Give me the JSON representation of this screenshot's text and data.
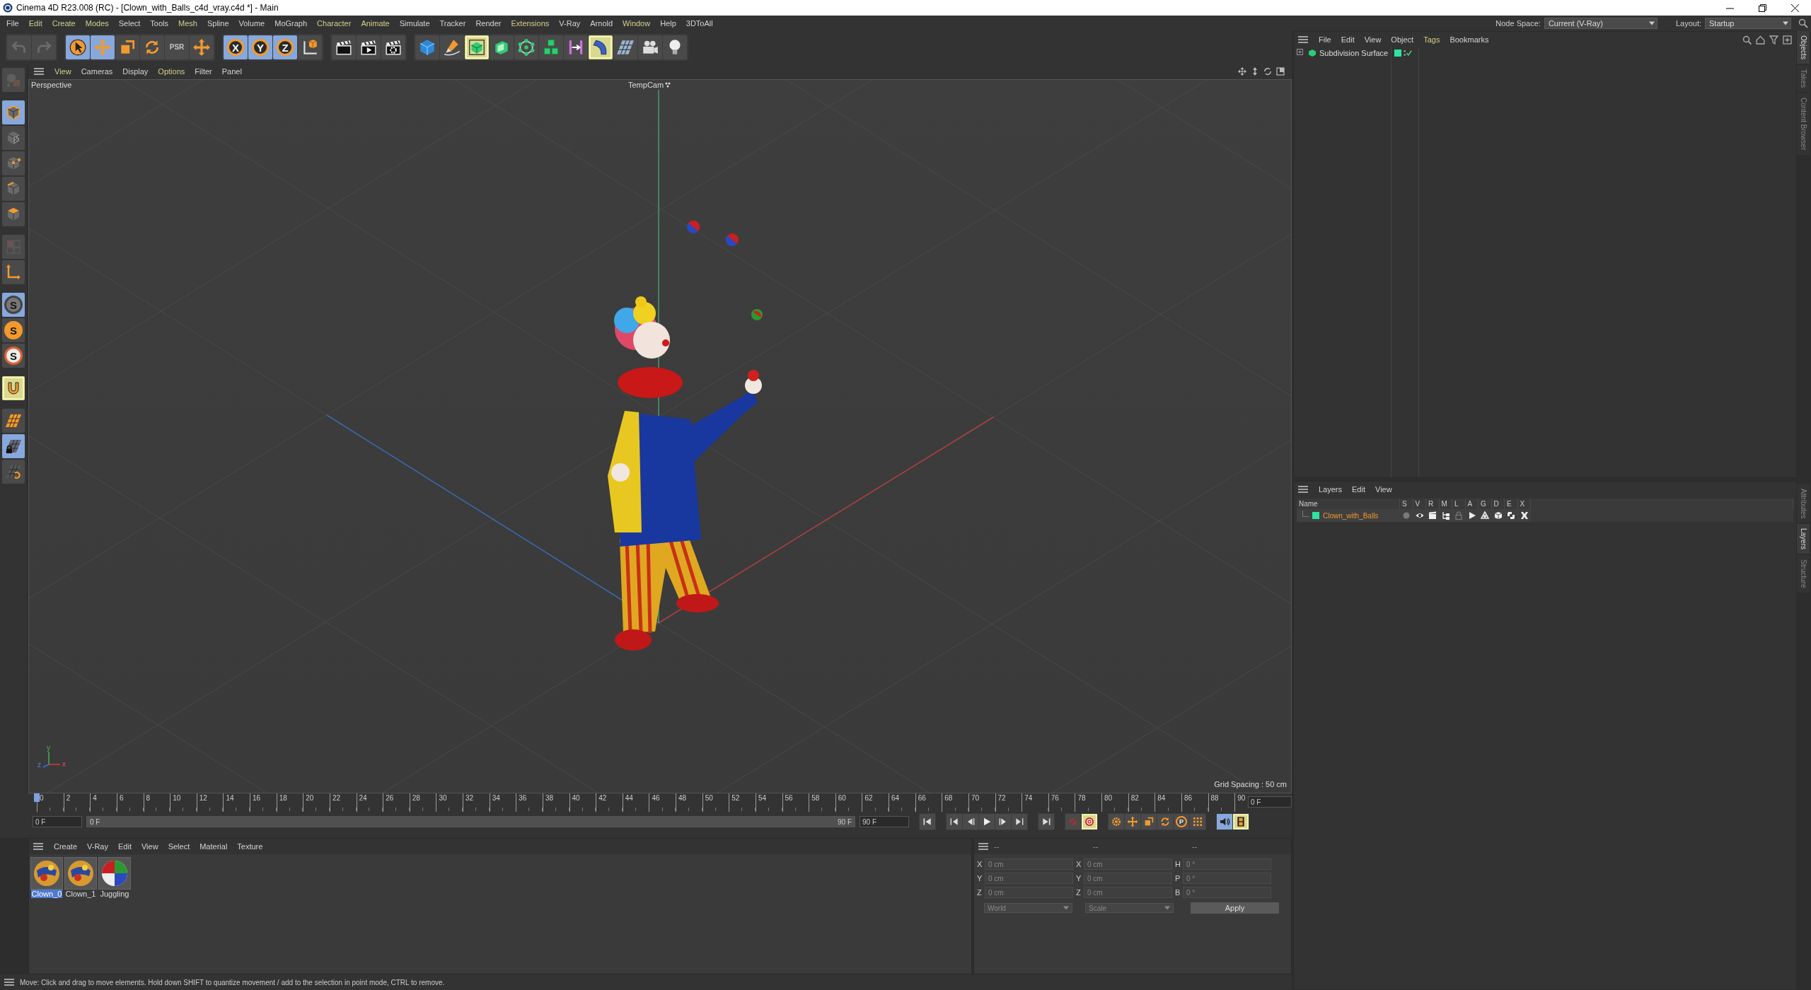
{
  "window": {
    "title": "Cinema 4D R23.008 (RC) - [Clown_with_Balls_c4d_vray.c4d *] - Main"
  },
  "menu_bar": {
    "items": [
      {
        "label": "File",
        "highlighted": false
      },
      {
        "label": "Edit",
        "highlighted": true
      },
      {
        "label": "Create",
        "highlighted": true
      },
      {
        "label": "Modes",
        "highlighted": true
      },
      {
        "label": "Select",
        "highlighted": false
      },
      {
        "label": "Tools",
        "highlighted": false
      },
      {
        "label": "Mesh",
        "highlighted": true
      },
      {
        "label": "Spline",
        "highlighted": false
      },
      {
        "label": "Volume",
        "highlighted": false
      },
      {
        "label": "MoGraph",
        "highlighted": false
      },
      {
        "label": "Character",
        "highlighted": true
      },
      {
        "label": "Animate",
        "highlighted": true
      },
      {
        "label": "Simulate",
        "highlighted": false
      },
      {
        "label": "Tracker",
        "highlighted": false
      },
      {
        "label": "Render",
        "highlighted": false
      },
      {
        "label": "Extensions",
        "highlighted": true
      },
      {
        "label": "V-Ray",
        "highlighted": false
      },
      {
        "label": "Arnold",
        "highlighted": false
      },
      {
        "label": "Window",
        "highlighted": true
      },
      {
        "label": "Help",
        "highlighted": false
      },
      {
        "label": "3DToAll",
        "highlighted": false
      }
    ],
    "node_space": {
      "label": "Node Space:",
      "value": "Current (V-Ray)"
    },
    "layout": {
      "label": "Layout:",
      "value": "Startup"
    }
  },
  "toolbar": [
    {
      "kind": "undo",
      "selected": false,
      "active": false,
      "disabled": true
    },
    {
      "kind": "redo",
      "selected": false,
      "active": false,
      "disabled": true
    },
    {
      "kind": "select",
      "selected": true,
      "active": false,
      "disabled": false
    },
    {
      "kind": "move",
      "selected": true,
      "active": false,
      "disabled": false
    },
    {
      "kind": "scale",
      "selected": false,
      "active": false,
      "disabled": false
    },
    {
      "kind": "rotate",
      "selected": false,
      "active": false,
      "disabled": false
    },
    {
      "kind": "psr",
      "label": "PSR",
      "selected": false,
      "active": false,
      "disabled": true
    },
    {
      "kind": "cross",
      "selected": false,
      "active": false,
      "disabled": false
    },
    {
      "kind": "axis",
      "label": "X",
      "selected": true,
      "active": false,
      "disabled": false
    },
    {
      "kind": "axis",
      "label": "Y",
      "selected": true,
      "active": false,
      "disabled": false
    },
    {
      "kind": "axis",
      "label": "Z",
      "selected": true,
      "active": false,
      "disabled": false
    },
    {
      "kind": "coords",
      "selected": false,
      "active": false,
      "disabled": false
    },
    {
      "kind": "clapper",
      "selected": false,
      "active": false,
      "disabled": false
    },
    {
      "kind": "render",
      "selected": false,
      "active": false,
      "disabled": false
    },
    {
      "kind": "render_settings",
      "selected": false,
      "active": false,
      "disabled": false
    },
    {
      "kind": "cube",
      "selected": false,
      "active": false,
      "disabled": false
    },
    {
      "kind": "pen",
      "selected": false,
      "active": false,
      "disabled": false
    },
    {
      "kind": "subdiv",
      "selected": false,
      "active": true,
      "disabled": false
    },
    {
      "kind": "extrude",
      "selected": false,
      "active": false,
      "disabled": false
    },
    {
      "kind": "cloner",
      "selected": false,
      "active": false,
      "disabled": false
    },
    {
      "kind": "cubes",
      "selected": false,
      "active": false,
      "disabled": false
    },
    {
      "kind": "bend",
      "selected": false,
      "active": false,
      "disabled": false
    },
    {
      "kind": "field",
      "selected": false,
      "active": true,
      "disabled": false
    },
    {
      "kind": "floor",
      "selected": false,
      "active": false,
      "disabled": false
    },
    {
      "kind": "camera",
      "selected": false,
      "active": false,
      "disabled": false
    },
    {
      "kind": "light",
      "selected": false,
      "active": false,
      "disabled": false
    }
  ],
  "left_toolbar": [
    {
      "kind": "editable",
      "selected": false,
      "active": false,
      "disabled": true
    },
    {
      "kind": "model",
      "selected": true,
      "active": false,
      "disabled": false
    },
    {
      "kind": "texture",
      "selected": false,
      "active": false,
      "disabled": false
    },
    {
      "kind": "points",
      "selected": false,
      "active": false,
      "disabled": false
    },
    {
      "kind": "edges",
      "selected": false,
      "active": false,
      "disabled": false
    },
    {
      "kind": "polys",
      "selected": false,
      "active": false,
      "disabled": false
    },
    {
      "kind": "uv",
      "selected": false,
      "active": false,
      "disabled": true
    },
    {
      "kind": "axis_mode",
      "selected": false,
      "active": false,
      "disabled": false
    },
    {
      "kind": "snap",
      "label": "S",
      "selected": true,
      "active": false,
      "disabled": false
    },
    {
      "kind": "snap_orange",
      "label": "S",
      "selected": false,
      "active": false,
      "disabled": false
    },
    {
      "kind": "snap_white",
      "label": "S",
      "selected": false,
      "active": false,
      "disabled": false
    },
    {
      "kind": "magnet",
      "selected": false,
      "active": true,
      "disabled": false
    },
    {
      "kind": "gridplane",
      "selected": false,
      "active": false,
      "disabled": false
    },
    {
      "kind": "gridlock",
      "selected": true,
      "active": false,
      "disabled": false
    },
    {
      "kind": "gridrot",
      "selected": false,
      "active": false,
      "disabled": false
    }
  ],
  "viewport": {
    "menu": [
      {
        "label": "View",
        "highlighted": true
      },
      {
        "label": "Cameras",
        "highlighted": false
      },
      {
        "label": "Display",
        "highlighted": false
      },
      {
        "label": "Options",
        "highlighted": true
      },
      {
        "label": "Filter",
        "highlighted": false
      },
      {
        "label": "Panel",
        "highlighted": false
      }
    ],
    "camera": "Perspective",
    "active_camera": "TempCam",
    "grid_spacing": "Grid Spacing : 50 cm",
    "gizmo_labels": [
      "z",
      "y",
      "x"
    ]
  },
  "objects_panel": {
    "menu": [
      {
        "label": "File",
        "highlighted": false
      },
      {
        "label": "Edit",
        "highlighted": false
      },
      {
        "label": "View",
        "highlighted": false
      },
      {
        "label": "Object",
        "highlighted": false
      },
      {
        "label": "Tags",
        "highlighted": true
      },
      {
        "label": "Bookmarks",
        "highlighted": false
      }
    ],
    "objects": [
      {
        "name": "Subdivision Surface",
        "color": "#2ee59d",
        "enabled": true
      }
    ]
  },
  "side_tabs": [
    {
      "label": "Objects",
      "selected": true
    },
    {
      "label": "Takes",
      "selected": false
    },
    {
      "label": "Content Browser",
      "selected": false
    }
  ],
  "layers_panel": {
    "menu": [
      {
        "label": "Layers",
        "highlighted": false
      },
      {
        "label": "Edit",
        "highlighted": false
      },
      {
        "label": "View",
        "highlighted": false
      }
    ],
    "columns": [
      "Name",
      "S",
      "V",
      "R",
      "M",
      "L",
      "A",
      "G",
      "D",
      "E",
      "X"
    ],
    "layers": [
      {
        "name": "Clown_with_Balls",
        "color": "#2ee5a0",
        "flags": [
          {
            "kind": "solo",
            "on": false
          },
          {
            "kind": "view",
            "on": true
          },
          {
            "kind": "render",
            "on": true
          },
          {
            "kind": "manager",
            "on": true
          },
          {
            "kind": "lock",
            "on": false
          },
          {
            "kind": "animation",
            "on": true
          },
          {
            "kind": "generators",
            "on": true
          },
          {
            "kind": "deformers",
            "on": true
          },
          {
            "kind": "expressions",
            "on": true
          },
          {
            "kind": "xrefs",
            "on": true
          }
        ]
      }
    ]
  },
  "side_tabs_lower": [
    {
      "label": "Attributes",
      "selected": false
    },
    {
      "label": "Layers",
      "selected": true
    },
    {
      "label": "Structure",
      "selected": false
    }
  ],
  "timeline": {
    "ticks": [
      "0",
      "2",
      "4",
      "6",
      "8",
      "10",
      "12",
      "14",
      "16",
      "18",
      "20",
      "22",
      "24",
      "26",
      "28",
      "30",
      "32",
      "34",
      "36",
      "38",
      "40",
      "42",
      "44",
      "46",
      "48",
      "50",
      "52",
      "54",
      "56",
      "58",
      "60",
      "62",
      "64",
      "66",
      "68",
      "70",
      "72",
      "74",
      "76",
      "78",
      "80",
      "82",
      "84",
      "86",
      "88",
      "90"
    ],
    "current_frame": "0 F",
    "start_field": "0 F",
    "range": {
      "start": "0 F",
      "end": "90 F",
      "level": 1
    },
    "end_field": "90 F",
    "controls": [
      {
        "kind": "first",
        "selected": false,
        "active": false
      },
      {
        "kind": "prev_key",
        "selected": false,
        "active": false
      },
      {
        "kind": "prev_frame",
        "selected": false,
        "active": false
      },
      {
        "kind": "play",
        "selected": false,
        "active": false
      },
      {
        "kind": "next_frame",
        "selected": false,
        "active": false
      },
      {
        "kind": "next_key",
        "selected": false,
        "active": false
      },
      {
        "kind": "last",
        "selected": false,
        "active": false
      },
      {
        "kind": "autokey",
        "selected": false,
        "active": false
      },
      {
        "kind": "record",
        "selected": false,
        "active": true
      },
      {
        "kind": "key_gear",
        "selected": false,
        "active": false
      },
      {
        "kind": "key_move",
        "selected": false,
        "active": false
      },
      {
        "kind": "key_scale",
        "selected": false,
        "active": false
      },
      {
        "kind": "key_rotate",
        "selected": false,
        "active": false
      },
      {
        "kind": "key_param",
        "label": "P",
        "selected": false,
        "active": false
      },
      {
        "kind": "key_grid",
        "selected": false,
        "active": false
      },
      {
        "kind": "sound",
        "selected": true,
        "active": false
      },
      {
        "kind": "film",
        "selected": false,
        "active": true
      }
    ]
  },
  "materials_panel": {
    "menu": [
      {
        "label": "Create",
        "highlighted": false
      },
      {
        "label": "V-Ray",
        "highlighted": false
      },
      {
        "label": "Edit",
        "highlighted": false
      },
      {
        "label": "View",
        "highlighted": false
      },
      {
        "label": "Select",
        "highlighted": false
      },
      {
        "label": "Material",
        "highlighted": false
      },
      {
        "label": "Texture",
        "highlighted": false
      }
    ],
    "materials": [
      {
        "label": "Clown_0",
        "kind": "clown",
        "selected": true
      },
      {
        "label": "Clown_1",
        "kind": "clown",
        "selected": false
      },
      {
        "label": "Juggling",
        "kind": "ball",
        "selected": false
      }
    ]
  },
  "coordinates_panel": {
    "headers": [
      "--",
      "--",
      "--"
    ],
    "rows": [
      [
        {
          "axis": "X",
          "placeholder": "0 cm"
        },
        {
          "axis": "X",
          "placeholder": "0 cm"
        },
        {
          "axis": "H",
          "placeholder": "0 °"
        }
      ],
      [
        {
          "axis": "Y",
          "placeholder": "0 cm"
        },
        {
          "axis": "Y",
          "placeholder": "0 cm"
        },
        {
          "axis": "P",
          "placeholder": "0 °"
        }
      ],
      [
        {
          "axis": "Z",
          "placeholder": "0 cm"
        },
        {
          "axis": "Z",
          "placeholder": "0 cm"
        },
        {
          "axis": "B",
          "placeholder": "0 °"
        }
      ]
    ],
    "space": "World",
    "mode": "Scale",
    "apply": "Apply"
  },
  "status_bar": {
    "text": "Move: Click and drag to move elements. Hold down SHIFT to quantize movement / add to the selection in point mode, CTRL to remove."
  }
}
